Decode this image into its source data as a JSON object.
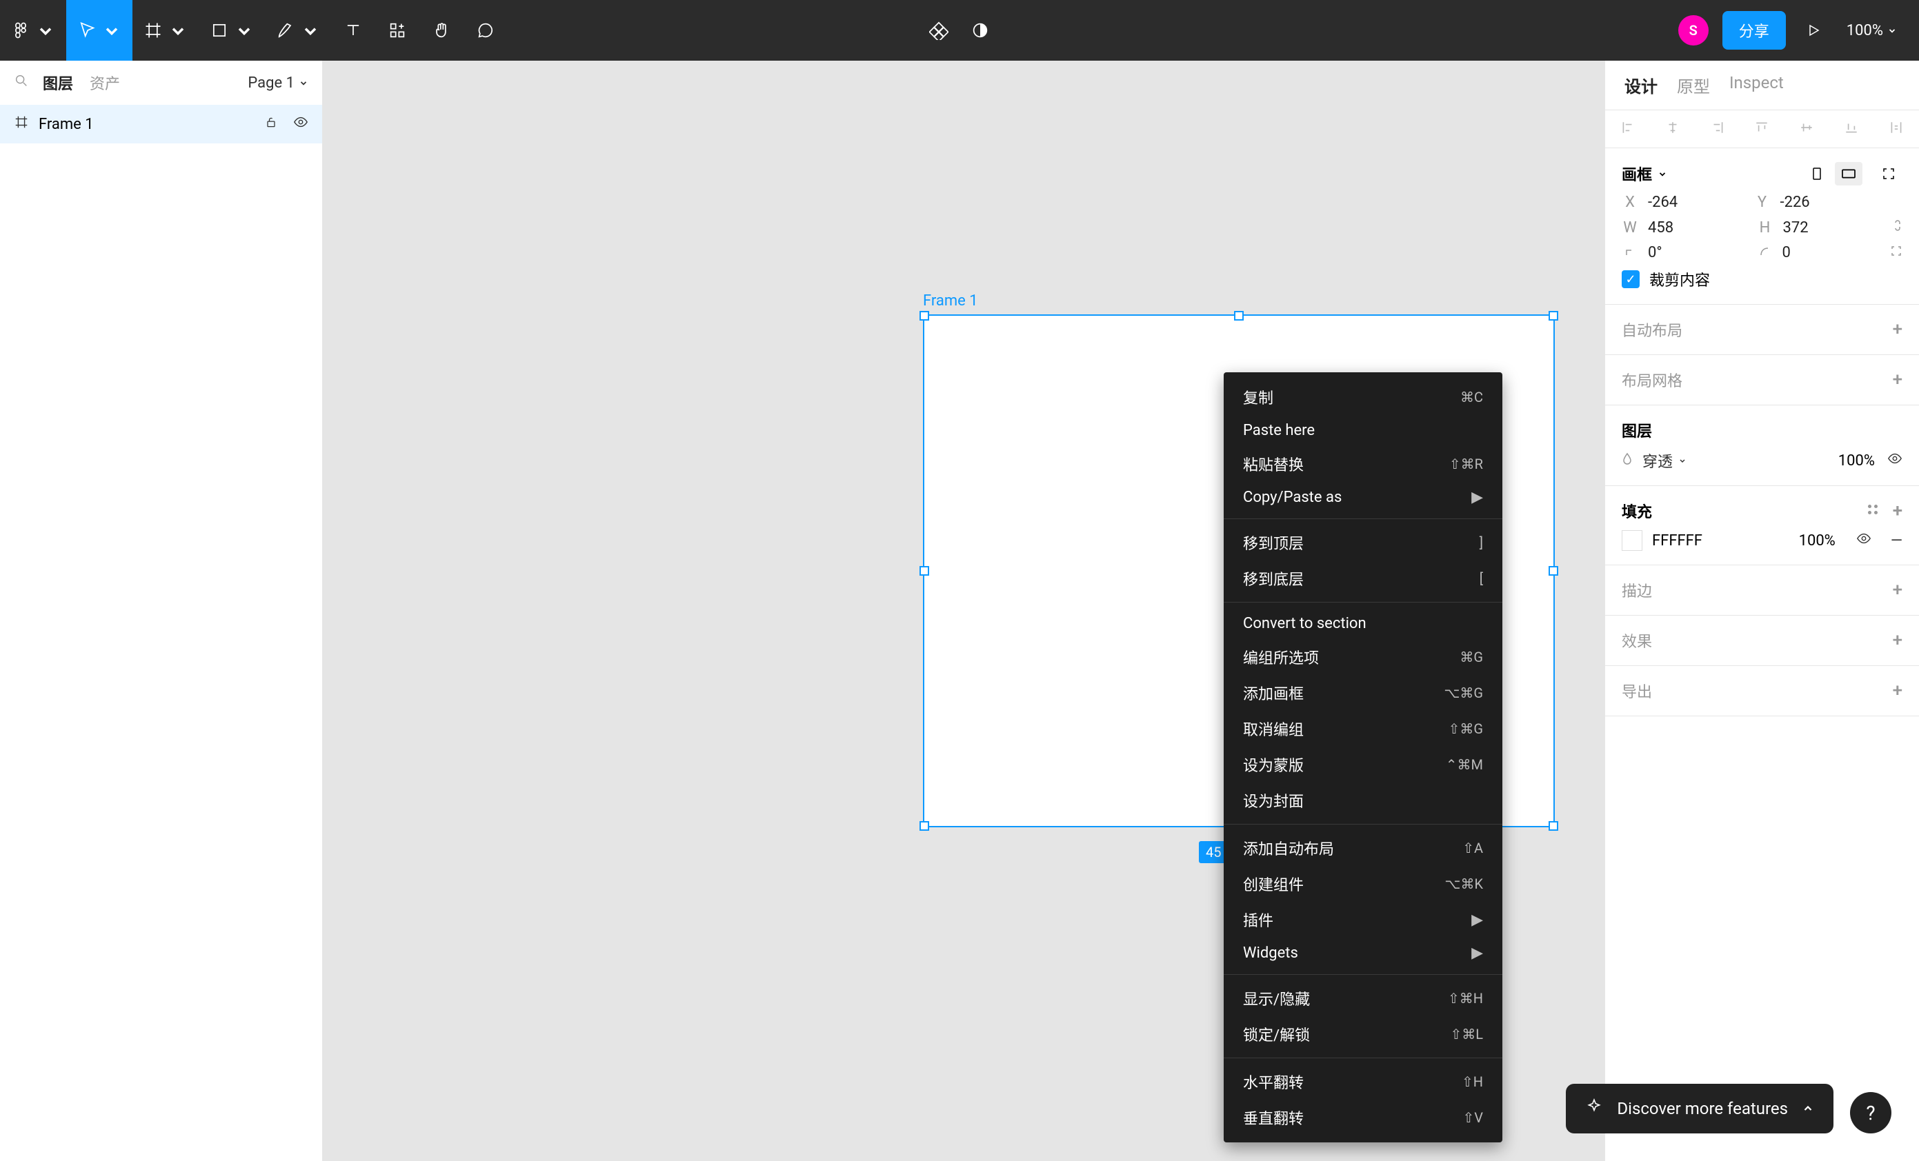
{
  "toolbar": {
    "avatar_initial": "S",
    "share_label": "分享",
    "zoom": "100%"
  },
  "left_panel": {
    "tabs": [
      "图层",
      "资产"
    ],
    "page_label": "Page 1",
    "layer_name": "Frame 1"
  },
  "canvas": {
    "frame_label": "Frame 1",
    "dim_badge": "45"
  },
  "context_menu": {
    "groups": [
      [
        {
          "label": "复制",
          "shortcut": "⌘C"
        },
        {
          "label": "Paste here",
          "shortcut": ""
        },
        {
          "label": "粘贴替换",
          "shortcut": "⇧⌘R"
        },
        {
          "label": "Copy/Paste as",
          "shortcut": "",
          "submenu": true
        }
      ],
      [
        {
          "label": "移到顶层",
          "shortcut": "]"
        },
        {
          "label": "移到底层",
          "shortcut": "["
        }
      ],
      [
        {
          "label": "Convert to section",
          "shortcut": ""
        },
        {
          "label": "编组所选项",
          "shortcut": "⌘G"
        },
        {
          "label": "添加画框",
          "shortcut": "⌥⌘G"
        },
        {
          "label": "取消编组",
          "shortcut": "⇧⌘G"
        },
        {
          "label": "设为蒙版",
          "shortcut": "⌃⌘M"
        },
        {
          "label": "设为封面",
          "shortcut": ""
        }
      ],
      [
        {
          "label": "添加自动布局",
          "shortcut": "⇧A"
        },
        {
          "label": "创建组件",
          "shortcut": "⌥⌘K"
        },
        {
          "label": "插件",
          "shortcut": "",
          "submenu": true
        },
        {
          "label": "Widgets",
          "shortcut": "",
          "submenu": true
        }
      ],
      [
        {
          "label": "显示/隐藏",
          "shortcut": "⇧⌘H"
        },
        {
          "label": "锁定/解锁",
          "shortcut": "⇧⌘L"
        }
      ],
      [
        {
          "label": "水平翻转",
          "shortcut": "⇧H"
        },
        {
          "label": "垂直翻转",
          "shortcut": "⇧V"
        }
      ]
    ]
  },
  "right_panel": {
    "tabs": [
      "设计",
      "原型",
      "Inspect"
    ],
    "frame": {
      "title": "画框",
      "x_label": "X",
      "x": "-264",
      "y_label": "Y",
      "y": "-226",
      "w_label": "W",
      "w": "458",
      "h_label": "H",
      "h": "372",
      "rot_label": "⌐",
      "rotation": "0°",
      "radius_label": "⌒",
      "radius": "0",
      "clip_label": "裁剪内容"
    },
    "auto_layout": "自动布局",
    "layout_grid": "布局网格",
    "layer_section": {
      "title": "图层",
      "blend": "穿透",
      "opacity": "100%"
    },
    "fill_section": {
      "title": "填充",
      "hex": "FFFFFF",
      "opacity": "100%"
    },
    "stroke": "描边",
    "effects": "效果",
    "export": "导出"
  },
  "discover_label": "Discover more features",
  "help_label": "?"
}
